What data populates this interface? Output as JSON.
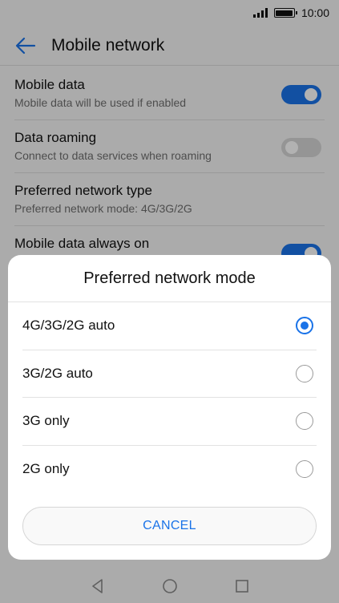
{
  "status_bar": {
    "time": "10:00",
    "signal_icon": "signal-icon",
    "battery_icon": "battery-icon",
    "battery_level": 1.0
  },
  "toolbar": {
    "title": "Mobile network",
    "back_icon": "arrow-left-icon"
  },
  "settings": [
    {
      "title": "Mobile data",
      "subtitle": "Mobile data will be used if enabled",
      "toggle": "on"
    },
    {
      "title": "Data roaming",
      "subtitle": "Connect to data services when roaming",
      "toggle": "off"
    },
    {
      "title": "Preferred network type",
      "subtitle": "Preferred network mode: 4G/3G/2G"
    },
    {
      "title": "Mobile data always on",
      "subtitle": "",
      "toggle": "on"
    }
  ],
  "dialog": {
    "title": "Preferred network mode",
    "options": [
      {
        "label": "4G/3G/2G auto",
        "selected": true
      },
      {
        "label": "3G/2G auto",
        "selected": false
      },
      {
        "label": "3G only",
        "selected": false
      },
      {
        "label": "2G only",
        "selected": false
      }
    ],
    "cancel_label": "CANCEL"
  },
  "nav_bar": {
    "back_icon": "triangle-back-icon",
    "home_icon": "circle-home-icon",
    "recents_icon": "square-recents-icon"
  },
  "colors": {
    "accent": "#1a73e8",
    "toggle_off": "#d6d6d6",
    "background": "#f5f5f5"
  }
}
